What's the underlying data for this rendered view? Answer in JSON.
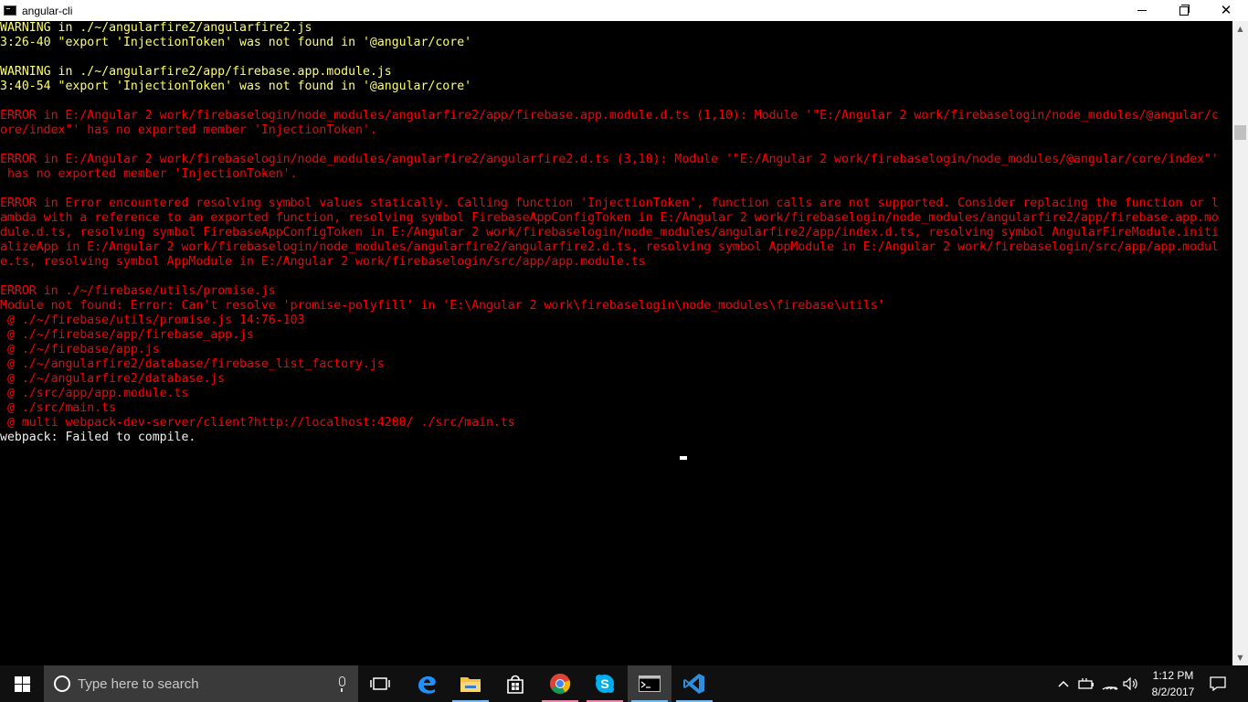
{
  "window": {
    "title": "angular-cli",
    "icon": "cmd-icon"
  },
  "console": {
    "lines": [
      {
        "type": "warn",
        "text": "WARNING in ./~/angularfire2/angularfire2.js"
      },
      {
        "type": "warn",
        "text": "3:26-40 \"export 'InjectionToken' was not found in '@angular/core'"
      },
      {
        "type": "plain",
        "text": ""
      },
      {
        "type": "warn",
        "text": "WARNING in ./~/angularfire2/app/firebase.app.module.js"
      },
      {
        "type": "warn",
        "text": "3:40-54 \"export 'InjectionToken' was not found in '@angular/core'"
      },
      {
        "type": "plain",
        "text": ""
      },
      {
        "type": "err",
        "text": "ERROR in E:/Angular 2 work/firebaselogin/node_modules/angularfire2/app/firebase.app.module.d.ts (1,10): Module '\"E:/Angular 2 work/firebaselogin/node_modules/@angular/c"
      },
      {
        "type": "err",
        "text": "ore/index\"' has no exported member 'InjectionToken'."
      },
      {
        "type": "plain",
        "text": ""
      },
      {
        "type": "err",
        "text": "ERROR in E:/Angular 2 work/firebaselogin/node_modules/angularfire2/angularfire2.d.ts (3,10): Module '\"E:/Angular 2 work/firebaselogin/node_modules/@angular/core/index\"'"
      },
      {
        "type": "err",
        "text": " has no exported member 'InjectionToken'."
      },
      {
        "type": "plain",
        "text": ""
      },
      {
        "type": "err",
        "text": "ERROR in Error encountered resolving symbol values statically. Calling function 'InjectionToken', function calls are not supported. Consider replacing the function or l"
      },
      {
        "type": "err",
        "text": "ambda with a reference to an exported function, resolving symbol FirebaseAppConfigToken in E:/Angular 2 work/firebaselogin/node_modules/angularfire2/app/firebase.app.mo"
      },
      {
        "type": "err",
        "text": "dule.d.ts, resolving symbol FirebaseAppConfigToken in E:/Angular 2 work/firebaselogin/node_modules/angularfire2/app/index.d.ts, resolving symbol AngularFireModule.initi"
      },
      {
        "type": "err",
        "text": "alizeApp in E:/Angular 2 work/firebaselogin/node_modules/angularfire2/angularfire2.d.ts, resolving symbol AppModule in E:/Angular 2 work/firebaselogin/src/app/app.modul"
      },
      {
        "type": "err",
        "text": "e.ts, resolving symbol AppModule in E:/Angular 2 work/firebaselogin/src/app/app.module.ts"
      },
      {
        "type": "plain",
        "text": ""
      },
      {
        "type": "err",
        "text": "ERROR in ./~/firebase/utils/promise.js"
      },
      {
        "type": "err",
        "text": "Module not found: Error: Can't resolve 'promise-polyfill' in 'E:\\Angular 2 work\\firebaselogin\\node_modules\\firebase\\utils'"
      },
      {
        "type": "err",
        "text": " @ ./~/firebase/utils/promise.js 14:76-103"
      },
      {
        "type": "err",
        "text": " @ ./~/firebase/app/firebase_app.js"
      },
      {
        "type": "err",
        "text": " @ ./~/firebase/app.js"
      },
      {
        "type": "err",
        "text": " @ ./~/angularfire2/database/firebase_list_factory.js"
      },
      {
        "type": "err",
        "text": " @ ./~/angularfire2/database.js"
      },
      {
        "type": "err",
        "text": " @ ./src/app/app.module.ts"
      },
      {
        "type": "err",
        "text": " @ ./src/main.ts"
      },
      {
        "type": "err",
        "text": " @ multi webpack-dev-server/client?http://localhost:4200/ ./src/main.ts"
      },
      {
        "type": "plain",
        "text": "webpack: Failed to compile."
      }
    ]
  },
  "taskbar": {
    "search_placeholder": "Type here to search",
    "apps": [
      {
        "name": "task-view-icon"
      },
      {
        "name": "edge-icon"
      },
      {
        "name": "file-explorer-icon"
      },
      {
        "name": "store-icon"
      },
      {
        "name": "chrome-icon"
      },
      {
        "name": "skype-icon"
      },
      {
        "name": "cmd-icon"
      },
      {
        "name": "vscode-icon"
      }
    ],
    "clock_time": "1:12 PM",
    "clock_date": "8/2/2017"
  },
  "colors": {
    "warning": "#ffff66",
    "error": "#ff0000",
    "text": "#f0f0f0",
    "background": "#000000",
    "taskbar": "#101010"
  }
}
